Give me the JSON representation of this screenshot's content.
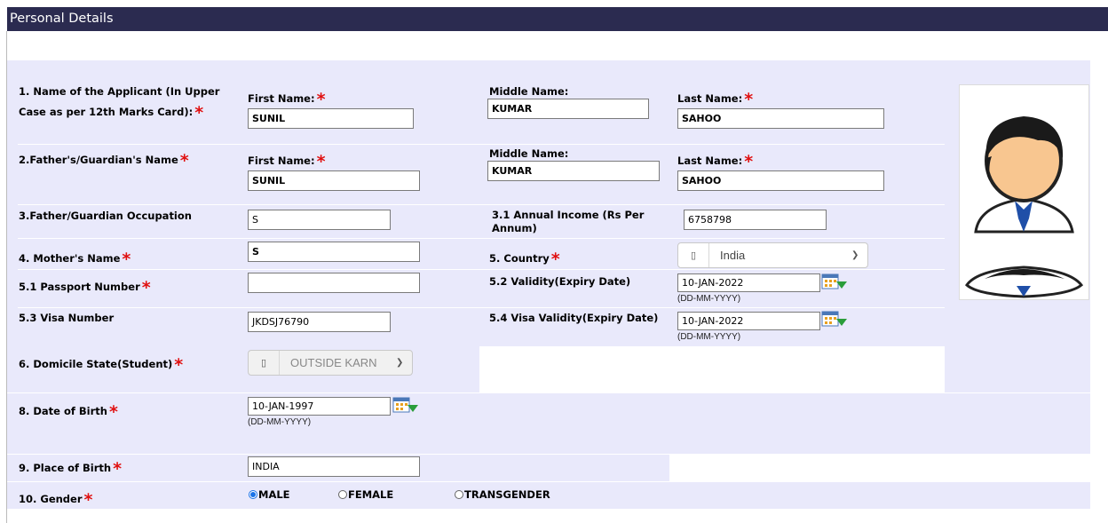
{
  "header": {
    "title": "Personal Details"
  },
  "form": {
    "applicant": {
      "label": "1. Name of the Applicant (In Upper",
      "label_line2": "Case as per 12th Marks Card):",
      "first_label": "First Name:",
      "first_value": "SUNIL",
      "middle_label": "Middle Name:",
      "middle_value": "KUMAR",
      "last_label": "Last Name:",
      "last_value": "SAHOO"
    },
    "father": {
      "label": "2.Father's/Guardian's Name",
      "first_label": "First Name:",
      "first_value": "SUNIL",
      "middle_label": "Middle Name:",
      "middle_value": "KUMAR",
      "last_label": "Last Name:",
      "last_value": "SAHOO"
    },
    "occupation": {
      "label": "3.Father/Guardian Occupation",
      "value": "S",
      "income_label": "3.1 Annual Income (Rs Per",
      "income_label_line2": "Annum)",
      "income_value": "6758798"
    },
    "mother": {
      "label": "4. Mother's Name",
      "value": "S"
    },
    "country": {
      "label": "5. Country",
      "selected": "India",
      "icon": "▯"
    },
    "passport": {
      "label": "5.1 Passport Number",
      "value": "",
      "validity_label": "5.2 Validity(Expiry Date)",
      "validity_value": "10-JAN-2022",
      "validity_hint": "(DD-MM-YYYY)"
    },
    "visa": {
      "label": "5.3  Visa Number",
      "value": "JKDSJ76790",
      "validity_label": "5.4  Visa Validity(Expiry Date)",
      "validity_value": "10-JAN-2022",
      "validity_hint": "(DD-MM-YYYY)"
    },
    "domicile": {
      "label": "6. Domicile State(Student)",
      "selected": "OUTSIDE KARN",
      "icon": "▯"
    },
    "dob": {
      "label": "8. Date of Birth",
      "value": "10-JAN-1997",
      "hint": "(DD-MM-YYYY)"
    },
    "place_of_birth": {
      "label": "9. Place of Birth",
      "value": "INDIA"
    },
    "gender": {
      "label": "10. Gender",
      "options": [
        "MALE",
        "FEMALE",
        "TRANSGENDER"
      ],
      "selected": "MALE"
    },
    "required_mark": "*"
  },
  "colors": {
    "header_bg": "#2b2b50",
    "band_bg": "#e9e9fb",
    "required": "#e01010"
  }
}
